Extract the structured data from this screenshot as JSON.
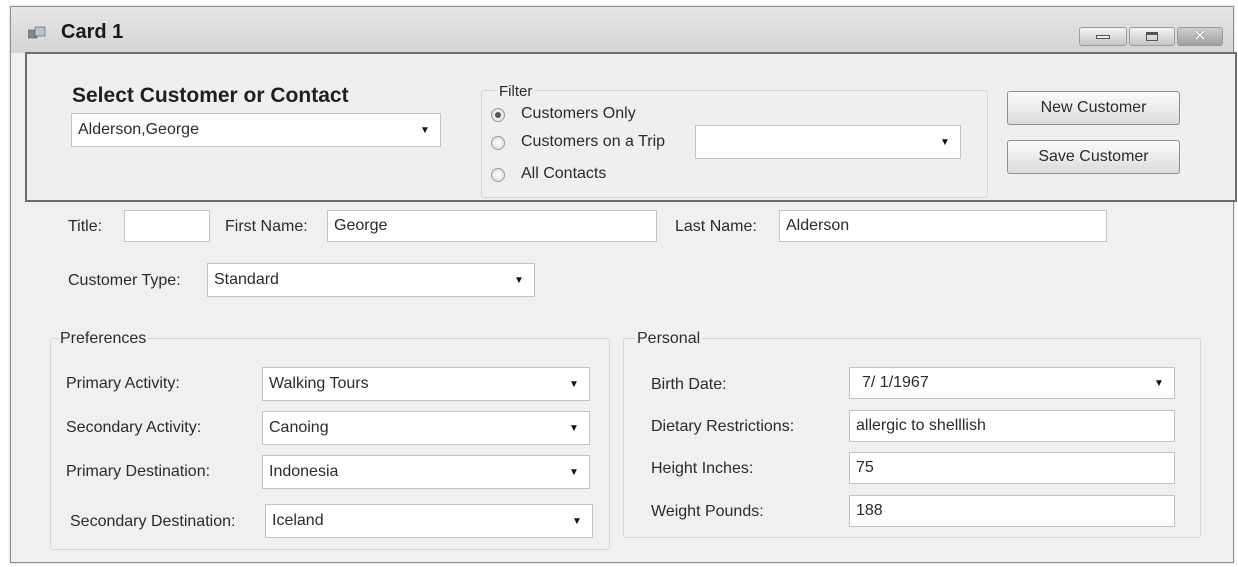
{
  "window": {
    "title": "Card 1"
  },
  "select": {
    "heading": "Select Customer or Contact",
    "value": "Alderson,George"
  },
  "filter": {
    "legend": "Filter",
    "options": [
      "Customers Only",
      "Customers on a Trip",
      "All Contacts"
    ],
    "selected": "Customers Only",
    "trip_value": ""
  },
  "buttons": {
    "new_customer": "New Customer",
    "save_customer": "Save Customer"
  },
  "contact": {
    "title_label": "Title:",
    "title_value": "",
    "first_name_label": "First Name:",
    "first_name_value": "George",
    "last_name_label": "Last Name:",
    "last_name_value": "Alderson",
    "customer_type_label": "Customer Type:",
    "customer_type_value": "Standard"
  },
  "preferences": {
    "legend": "Preferences",
    "primary_activity_label": "Primary Activity:",
    "primary_activity_value": "Walking Tours",
    "secondary_activity_label": "Secondary Activity:",
    "secondary_activity_value": "Canoing",
    "primary_destination_label": "Primary Destination:",
    "primary_destination_value": "Indonesia",
    "secondary_destination_label": "Secondary Destination:",
    "secondary_destination_value": "Iceland"
  },
  "personal": {
    "legend": "Personal",
    "birth_date_label": "Birth Date:",
    "birth_date_value": "7/ 1/1967",
    "dietary_label": "Dietary Restrictions:",
    "dietary_value": "allergic to shelllish",
    "height_label": "Height Inches:",
    "height_value": "75",
    "weight_label": "Weight Pounds:",
    "weight_value": "188"
  }
}
